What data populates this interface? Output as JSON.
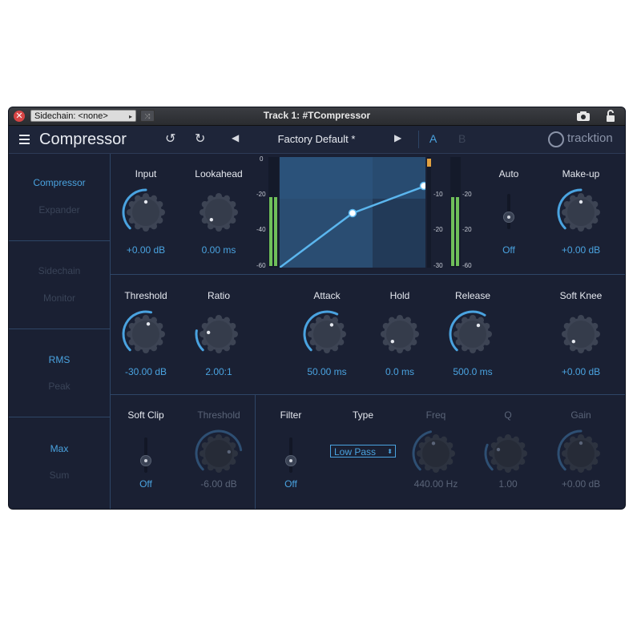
{
  "window": {
    "title": "Track 1: #TCompressor",
    "sidechain_select": "Sidechain: <none>"
  },
  "header": {
    "plugin_name": "Compressor",
    "preset": "Factory Default *",
    "ab_a": "A",
    "ab_b": "B",
    "brand": "tracktion"
  },
  "sidebar": {
    "mode_compressor": "Compressor",
    "mode_expander": "Expander",
    "sidechain": "Sidechain",
    "monitor": "Monitor",
    "rms": "RMS",
    "peak": "Peak",
    "max": "Max",
    "sum": "Sum"
  },
  "controls": {
    "input": {
      "label": "Input",
      "value": "+0.00 dB",
      "level": 0.5
    },
    "lookahead": {
      "label": "Lookahead",
      "value": "0.00 ms",
      "level": 0.0
    },
    "auto": {
      "label": "Auto",
      "value": "Off"
    },
    "makeup": {
      "label": "Make-up",
      "value": "+0.00 dB",
      "level": 0.5
    },
    "threshold": {
      "label": "Threshold",
      "value": "-30.00 dB",
      "level": 0.55
    },
    "ratio": {
      "label": "Ratio",
      "value": "2.00:1",
      "level": 0.2
    },
    "attack": {
      "label": "Attack",
      "value": "50.00 ms",
      "level": 0.6
    },
    "hold": {
      "label": "Hold",
      "value": "0.0 ms",
      "level": 0.0
    },
    "release": {
      "label": "Release",
      "value": "500.0 ms",
      "level": 0.62
    },
    "soft_knee": {
      "label": "Soft Knee",
      "value": "+0.00 dB",
      "level": 0.0
    },
    "soft_clip": {
      "label": "Soft Clip",
      "value": "Off"
    },
    "clip_threshold": {
      "label": "Threshold",
      "value": "-6.00 dB",
      "level": 0.8
    },
    "filter": {
      "label": "Filter",
      "value": "Off"
    },
    "type": {
      "label": "Type",
      "value": "Low Pass"
    },
    "freq": {
      "label": "Freq",
      "value": "440.00 Hz",
      "level": 0.45
    },
    "q": {
      "label": "Q",
      "value": "1.00",
      "level": 0.25
    },
    "gain": {
      "label": "Gain",
      "value": "+0.00 dB",
      "level": 0.5
    }
  },
  "meters": {
    "input_scale": [
      "0",
      "-20",
      "-40",
      "-60"
    ],
    "output_scale": [
      "-10",
      "-20",
      "-30"
    ],
    "gr_scale": [
      "-20",
      "-20",
      "-60"
    ],
    "top_label": "0"
  },
  "colors": {
    "accent": "#4aa3e0",
    "background": "#1a2033",
    "meter_green": "#6fbf5a"
  }
}
